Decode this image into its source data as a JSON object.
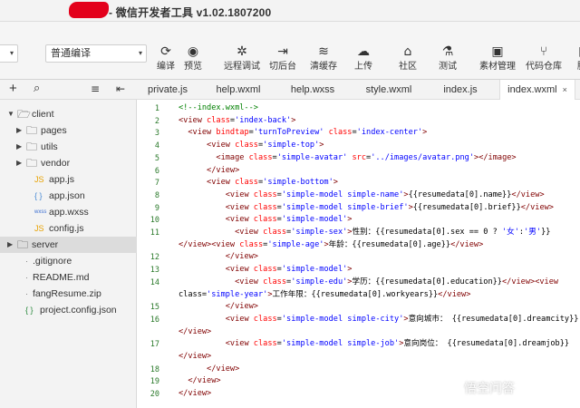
{
  "window": {
    "title": "- 微信开发者工具 v1.02.1807200"
  },
  "toolbar": {
    "mode_left": "▾",
    "mode": "普通编译",
    "buttons": [
      {
        "icon": "refresh-icon",
        "glyph": "⟳",
        "label": "编译"
      },
      {
        "icon": "eye-icon",
        "glyph": "◉",
        "label": "预览"
      },
      {
        "icon": "bug-icon",
        "glyph": "✲",
        "label": "远程调试"
      },
      {
        "icon": "switch-background-icon",
        "glyph": "⇥",
        "label": "切后台"
      },
      {
        "icon": "layers-icon",
        "glyph": "≋",
        "label": "清缓存"
      },
      {
        "icon": "upload-cloud-icon",
        "glyph": "☁",
        "label": "上传"
      },
      {
        "icon": "community-icon",
        "glyph": "⌂",
        "label": "社区"
      },
      {
        "icon": "test-flask-icon",
        "glyph": "⚗",
        "label": "测试"
      },
      {
        "icon": "material-manage-icon",
        "glyph": "▣",
        "label": "素材管理"
      },
      {
        "icon": "code-repository-icon",
        "glyph": "⑂",
        "label": "代码仓库"
      },
      {
        "icon": "more-icon",
        "glyph": "▮",
        "label": "腾"
      }
    ]
  },
  "filebar": {
    "add": "+",
    "search": "⌕",
    "menu": "≡",
    "collapse": "⇤"
  },
  "tree": [
    {
      "name": "client",
      "indent": 0,
      "type": "folder-open"
    },
    {
      "name": "pages",
      "indent": 1,
      "type": "folder"
    },
    {
      "name": "utils",
      "indent": 1,
      "type": "folder"
    },
    {
      "name": "vendor",
      "indent": 1,
      "type": "folder"
    },
    {
      "name": "app.js",
      "indent": 1,
      "type": "js",
      "badge": "JS"
    },
    {
      "name": "app.json",
      "indent": 1,
      "type": "json",
      "badge": "{ }"
    },
    {
      "name": "app.wxss",
      "indent": 1,
      "type": "wxss",
      "badge": "wxss"
    },
    {
      "name": "config.js",
      "indent": 1,
      "type": "js",
      "badge": "JS"
    },
    {
      "name": "server",
      "indent": 0,
      "type": "folder",
      "selected": true
    },
    {
      "name": ".gitignore",
      "indent": 0,
      "type": "file"
    },
    {
      "name": "README.md",
      "indent": 0,
      "type": "file"
    },
    {
      "name": "fangResume.zip",
      "indent": 0,
      "type": "file"
    },
    {
      "name": "project.config.json",
      "indent": 0,
      "type": "json",
      "badge": "{ }"
    }
  ],
  "tabs": [
    "private.js",
    "help.wxml",
    "help.wxss",
    "style.wxml",
    "index.js",
    "index.wxml"
  ],
  "active_tab_close": "×",
  "code": [
    {
      "n": "1",
      "t": "<!--index.wxml-->"
    },
    {
      "n": "2",
      "t": "<view class='index-back'>"
    },
    {
      "n": "3",
      "t": "  <view bindtap='turnToPreview' class='index-center'>"
    },
    {
      "n": "4",
      "t": "      <view class='simple-top'>"
    },
    {
      "n": "5",
      "t": "        <image class='simple-avatar' src='../images/avatar.png'></image>"
    },
    {
      "n": "6",
      "t": "      </view>"
    },
    {
      "n": "7",
      "t": "      <view class='simple-bottom'>"
    },
    {
      "n": "8",
      "t": "          <view class='simple-model simple-name'>{{resumedata[0].name}}</view>"
    },
    {
      "n": "9",
      "t": "          <view class='simple-model simple-brief'>{{resumedata[0].brief}}</view>"
    },
    {
      "n": "10",
      "t": "          <view class='simple-model'>"
    },
    {
      "n": "11",
      "t": "            <view class='simple-sex'>性别：{{resumedata[0].sex == 0 ? '女':'男'}}"
    },
    {
      "n": "",
      "t": "</view><view class='simple-age'>年龄：{{resumedata[0].age}}</view>"
    },
    {
      "n": "12",
      "t": "          </view>"
    },
    {
      "n": "13",
      "t": "          <view class='simple-model'>"
    },
    {
      "n": "14",
      "t": "            <view class='simple-edu'>学历：{{resumedata[0].education}}</view><view"
    },
    {
      "n": "",
      "t": "class='simple-year'>工作年限：{{resumedata[0].workyears}}</view>"
    },
    {
      "n": "15",
      "t": "          </view>"
    },
    {
      "n": "16",
      "t": "          <view class='simple-model simple-city'>意向城市： {{resumedata[0].dreamcity}}"
    },
    {
      "n": "",
      "t": "</view>"
    },
    {
      "n": "17",
      "t": "          <view class='simple-model simple-job'>意向岗位： {{resumedata[0].dreamjob}}"
    },
    {
      "n": "",
      "t": "</view>"
    },
    {
      "n": "18",
      "t": "      </view>"
    },
    {
      "n": "19",
      "t": "  </view>"
    },
    {
      "n": "20",
      "t": "</view>"
    }
  ],
  "watermark": "悟空问答"
}
